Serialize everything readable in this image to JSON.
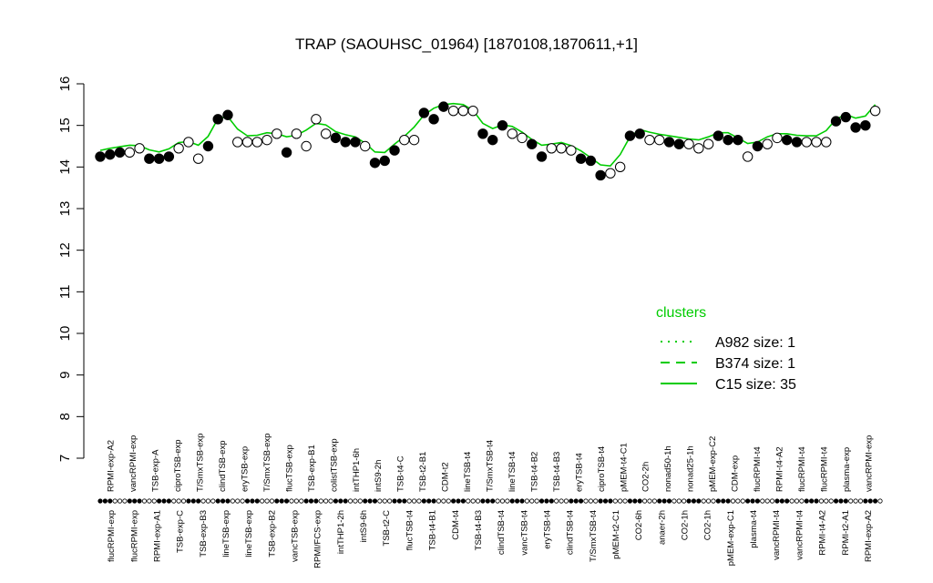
{
  "chart_data": {
    "type": "scatter",
    "title": "TRAP (SAOUHSC_01964) [1870108,1870611,+1]",
    "xlabel": "",
    "ylabel": "",
    "ylim": [
      7,
      16
    ],
    "yticks": [
      7,
      8,
      9,
      10,
      11,
      12,
      13,
      14,
      15,
      16
    ],
    "n_samples": 160,
    "points": [
      [
        1,
        14.25,
        1
      ],
      [
        3,
        14.3,
        1
      ],
      [
        5,
        14.35,
        1
      ],
      [
        7,
        14.35,
        0
      ],
      [
        9,
        14.45,
        0
      ],
      [
        11,
        14.2,
        1
      ],
      [
        13,
        14.2,
        1
      ],
      [
        15,
        14.25,
        1
      ],
      [
        17,
        14.45,
        0
      ],
      [
        19,
        14.6,
        0
      ],
      [
        21,
        14.2,
        0
      ],
      [
        23,
        14.5,
        1
      ],
      [
        25,
        15.15,
        1
      ],
      [
        27,
        15.25,
        1
      ],
      [
        29,
        14.6,
        0
      ],
      [
        31,
        14.6,
        0
      ],
      [
        33,
        14.6,
        0
      ],
      [
        35,
        14.65,
        0
      ],
      [
        37,
        14.8,
        0
      ],
      [
        39,
        14.35,
        1
      ],
      [
        41,
        14.8,
        0
      ],
      [
        43,
        14.5,
        0
      ],
      [
        45,
        15.15,
        0
      ],
      [
        47,
        14.8,
        0
      ],
      [
        49,
        14.7,
        1
      ],
      [
        51,
        14.6,
        1
      ],
      [
        53,
        14.6,
        1
      ],
      [
        55,
        14.5,
        0
      ],
      [
        57,
        14.1,
        1
      ],
      [
        59,
        14.15,
        1
      ],
      [
        61,
        14.4,
        1
      ],
      [
        63,
        14.65,
        0
      ],
      [
        65,
        14.65,
        0
      ],
      [
        67,
        15.3,
        1
      ],
      [
        69,
        15.15,
        1
      ],
      [
        71,
        15.45,
        1
      ],
      [
        73,
        15.35,
        0
      ],
      [
        75,
        15.35,
        0
      ],
      [
        77,
        15.35,
        0
      ],
      [
        79,
        14.8,
        1
      ],
      [
        81,
        14.65,
        1
      ],
      [
        83,
        15.0,
        1
      ],
      [
        85,
        14.8,
        0
      ],
      [
        87,
        14.7,
        0
      ],
      [
        89,
        14.55,
        1
      ],
      [
        91,
        14.25,
        1
      ],
      [
        93,
        14.45,
        0
      ],
      [
        95,
        14.45,
        0
      ],
      [
        97,
        14.4,
        0
      ],
      [
        99,
        14.2,
        1
      ],
      [
        101,
        14.15,
        1
      ],
      [
        103,
        13.8,
        1
      ],
      [
        105,
        13.85,
        0
      ],
      [
        107,
        14.0,
        0
      ],
      [
        109,
        14.75,
        1
      ],
      [
        111,
        14.8,
        1
      ],
      [
        113,
        14.65,
        0
      ],
      [
        115,
        14.65,
        0
      ],
      [
        117,
        14.6,
        1
      ],
      [
        119,
        14.55,
        1
      ],
      [
        121,
        14.55,
        0
      ],
      [
        123,
        14.45,
        0
      ],
      [
        125,
        14.55,
        0
      ],
      [
        127,
        14.75,
        1
      ],
      [
        129,
        14.65,
        1
      ],
      [
        131,
        14.65,
        1
      ],
      [
        133,
        14.25,
        0
      ],
      [
        135,
        14.5,
        1
      ],
      [
        137,
        14.55,
        0
      ],
      [
        139,
        14.7,
        0
      ],
      [
        141,
        14.65,
        1
      ],
      [
        143,
        14.6,
        1
      ],
      [
        145,
        14.6,
        0
      ],
      [
        147,
        14.6,
        0
      ],
      [
        149,
        14.6,
        0
      ],
      [
        151,
        15.1,
        1
      ],
      [
        153,
        15.2,
        1
      ],
      [
        155,
        14.95,
        1
      ],
      [
        157,
        15.0,
        1
      ],
      [
        159,
        15.35,
        0
      ]
    ]
  },
  "legend": {
    "title": "clusters",
    "items": [
      {
        "label": "A982 size: 1",
        "style": "dotted"
      },
      {
        "label": "B374 size: 1",
        "style": "dashed"
      },
      {
        "label": "C15 size: 35",
        "style": "solid"
      }
    ]
  },
  "top_labels": [
    "flucRPMI-exp",
    "flucRPMI-exp",
    "RPMI-exp-A1",
    "TSB-exp-C",
    "TSB-exp-B3",
    "lineTSB-exp",
    "lineTSB-exp",
    "TSB-exp-B2",
    "vancTSB-exp",
    "RPMI/FCS-exp",
    "intTHP1-2h",
    "intS9-6h",
    "TSB-t2-C",
    "flucTSB-t4",
    "TSB-t4-B1",
    "CDM-t4",
    "TSB-t4-B3",
    "clindTSB-t4",
    "vancTSB-t4",
    "eryTSB-t4",
    "clindTSB-t4",
    "T/SmxTSB-t4",
    "pMEM-t2-C1",
    "CO2-6h",
    "anaer-2h",
    "CO2-1h",
    "CO2-1h",
    "pMEM-exp-C1",
    "plasma-t4",
    "vancRPMI-t4",
    "vancRPMI-t4",
    "RPMI-t4-A2",
    "RPMI-t2-A1",
    "RPMI-exp-A2"
  ],
  "upper_labels": [
    "RPMI-exp-A2",
    "vancRPMI-exp",
    "TSB-exp-A",
    "ciproTSB-exp",
    "T/SmxTSB-exp",
    "clindTSB-exp",
    "eryTSB-exp",
    "T/SmxTSB-exp",
    "flucTSB-exp",
    "TSB-exp-B1",
    "colistTSB-exp",
    "intTHP1-6h",
    "intS9-2h",
    "TSB-t4-C",
    "TSB-t2-B1",
    "CDM-t2",
    "lineTSB-t4",
    "T/SmxTSB-t4",
    "lineTSB-t4",
    "TSB-t4-B2",
    "TSB-t4-B3",
    "eryTSB-t4",
    "ciproTSB-t4",
    "pMEM-t4-C1",
    "CO2-2h",
    "nonad50-1h",
    "nonad25-1h",
    "pMEM-exp-C2",
    "CDM-exp",
    "flucRPMI-t4",
    "RPMI-t4-A2",
    "flucRPMI-t4",
    "flucRPMI-t4",
    "plasma-exp",
    "vancRPMI-exp"
  ]
}
